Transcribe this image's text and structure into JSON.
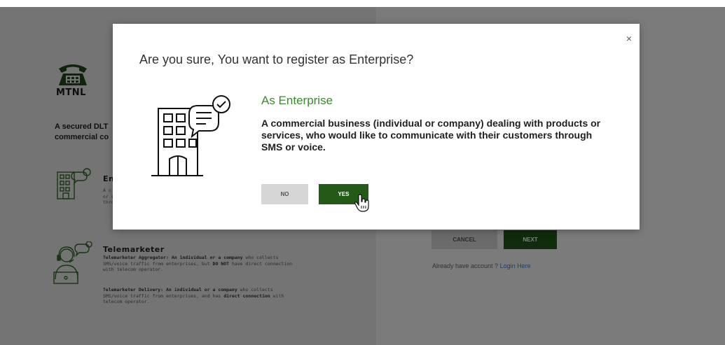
{
  "background": {
    "logo_text": "MTNL",
    "tagline_line1": "A secured DLT",
    "tagline_line2": "commercial co",
    "roles": [
      {
        "title": "En",
        "desc_lines": [
          "A c",
          "or s",
          "thro"
        ]
      },
      {
        "title": "Telemarketer",
        "aggregator_label": "Telemarketer Aggregator:",
        "aggregator_text_1": " An individual or a company",
        "aggregator_text_2": " who collects",
        "aggregator_line2": "SMS/voice traffic from enterprises, but",
        "aggregator_do_not": " DO NOT",
        "aggregator_line2b": " have direct connection",
        "aggregator_line3": "with telecom operator.",
        "delivery_label": "Telemarketer Delivery:",
        "delivery_text_1": " An individual or a company",
        "delivery_text_2": " who collects",
        "delivery_line2": "SMS/voice traffic from enterprises, and has",
        "delivery_direct": " direct connection",
        "delivery_line2b": " with",
        "delivery_line3": "telecom operator."
      }
    ],
    "cancel_label": "CANCEL",
    "next_label": "NEXT",
    "login_prompt": "Already have account ?",
    "login_link": "Login Here"
  },
  "modal": {
    "close_label": "×",
    "title": "Are you sure, You want to register as Enterprise?",
    "subtitle": "As Enterprise",
    "description": "A commercial business (individual or company) dealing with products or services, who would like to communicate with their customers through SMS or voice.",
    "no_label": "NO",
    "yes_label": "YES",
    "icon": "enterprise-building-icon"
  },
  "colors": {
    "accent_green": "#245a18",
    "subtitle_green": "#3b8a2c",
    "overlay": "rgba(0,0,0,0.5)"
  }
}
